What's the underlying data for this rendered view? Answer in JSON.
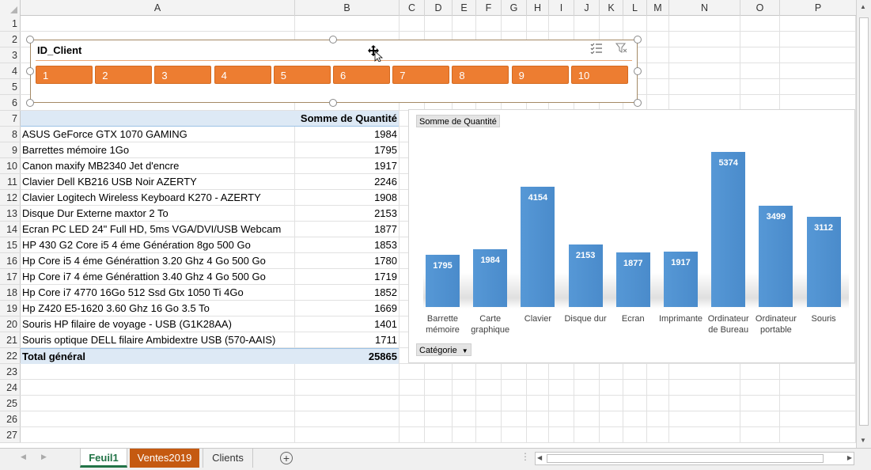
{
  "columns": [
    "A",
    "B",
    "C",
    "D",
    "E",
    "F",
    "G",
    "H",
    "I",
    "J",
    "K",
    "L",
    "M",
    "N",
    "O",
    "P"
  ],
  "rows": [
    "1",
    "2",
    "3",
    "4",
    "5",
    "6",
    "7",
    "8",
    "9",
    "10",
    "11",
    "12",
    "13",
    "14",
    "15",
    "16",
    "17",
    "18",
    "19",
    "20",
    "21",
    "22",
    "23",
    "24",
    "25",
    "26",
    "27"
  ],
  "slicer": {
    "title": "ID_Client",
    "buttons": [
      "1",
      "2",
      "3",
      "4",
      "5",
      "6",
      "7",
      "8",
      "9",
      "10"
    ],
    "multiselect_icon": "multi-select-icon",
    "clear_filter_icon": "clear-filter-icon",
    "accent": "#ed7d31"
  },
  "pivot": {
    "header_label": "Somme de Quantité",
    "rows": [
      {
        "label": "ASUS GeForce GTX 1070 GAMING",
        "value": "1984"
      },
      {
        "label": "Barrettes mémoire 1Go",
        "value": "1795"
      },
      {
        "label": "Canon maxify MB2340 Jet d'encre",
        "value": "1917"
      },
      {
        "label": "Clavier Dell KB216 USB Noir AZERTY",
        "value": "2246"
      },
      {
        "label": "Clavier Logitech Wireless Keyboard K270 - AZERTY",
        "value": "1908"
      },
      {
        "label": "Disque Dur Externe maxtor 2 To",
        "value": "2153"
      },
      {
        "label": "Ecran PC LED 24\" Full HD, 5ms VGA/DVI/USB Webcam",
        "value": "1877"
      },
      {
        "label": "HP 430 G2 Core i5 4 éme Génération 8go 500 Go",
        "value": "1853"
      },
      {
        "label": "Hp Core i5 4 éme Générattion 3.20 Ghz 4 Go 500 Go",
        "value": "1780"
      },
      {
        "label": "Hp Core i7 4 éme Générattion 3.40 Ghz 4 Go 500 Go",
        "value": "1719"
      },
      {
        "label": "Hp Core i7 4770 16Go 512 Ssd Gtx 1050 Ti 4Go",
        "value": "1852"
      },
      {
        "label": "Hp Z420 E5-1620 3.60 Ghz 16 Go 3.5 To",
        "value": "1669"
      },
      {
        "label": "Souris HP filaire de voyage - USB (G1K28AA)",
        "value": "1401"
      },
      {
        "label": "Souris optique DELL filaire Ambidextre USB (570-AAIS)",
        "value": "1711"
      }
    ],
    "total_label": "Total général",
    "total_value": "25865"
  },
  "chart_data": {
    "type": "bar",
    "value_field_label": "Somme  de Quantité",
    "category_field_label": "Catégorie",
    "categories": [
      [
        "Barrette",
        "mémoire"
      ],
      [
        "Carte",
        "graphique"
      ],
      [
        "Clavier"
      ],
      [
        "Disque dur"
      ],
      [
        "Ecran"
      ],
      [
        "Imprimante"
      ],
      [
        "Ordinateur",
        "de Bureau"
      ],
      [
        "Ordinateur",
        "portable"
      ],
      [
        "Souris"
      ]
    ],
    "values": [
      1795,
      1984,
      4154,
      2153,
      1877,
      1917,
      5374,
      3499,
      3112
    ],
    "bar_color": "#5698d6",
    "ylim": [
      0,
      5500
    ],
    "grid": false
  },
  "sheets": {
    "tabs": [
      "Feuil1",
      "Ventes2019",
      "Clients"
    ],
    "active": "Feuil1",
    "add_icon": "add-sheet-icon"
  },
  "colors": {
    "pivot_header_bg": "#dde9f5",
    "active_tab": "#217346",
    "highlight_tab": "#c55a11"
  }
}
